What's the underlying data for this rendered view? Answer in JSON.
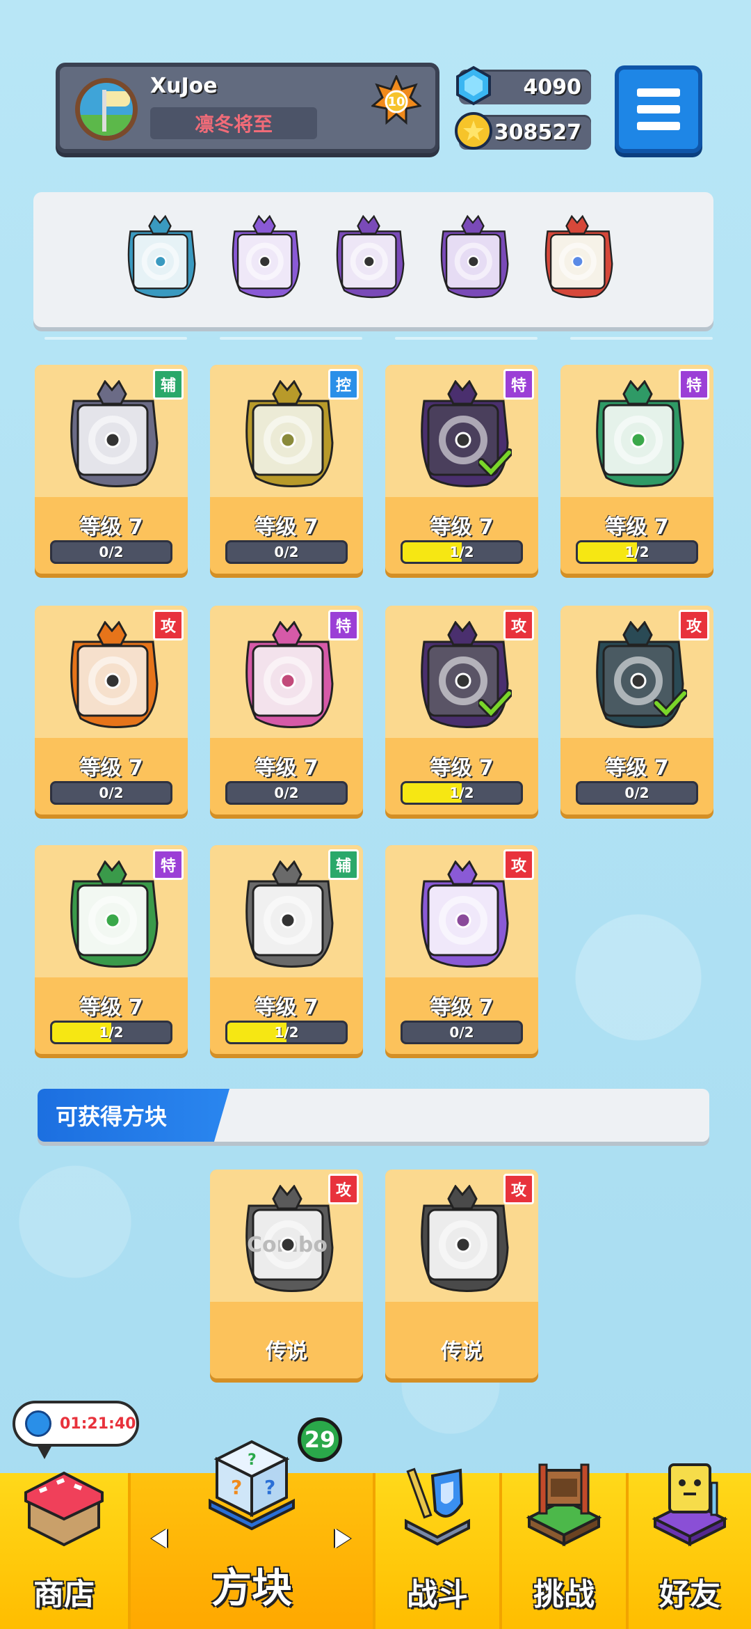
{
  "player": {
    "name": "XuJoe",
    "title": "凛冬将至",
    "rank": "10"
  },
  "currency": {
    "gems": "4090",
    "coins": "308527"
  },
  "colors": {
    "background": "#aee0f3",
    "card": "#fcc25b",
    "progress_fill": "#f6e713",
    "tag_fu": "#2aa86a",
    "tag_kong": "#2a8fe8",
    "tag_te": "#9b3fd6",
    "tag_gong": "#e8323c",
    "nav": "#ffc20e"
  },
  "deck": [
    {
      "icon": "blue-vortex-block-icon"
    },
    {
      "icon": "purple-atom-block-icon"
    },
    {
      "icon": "purple-triangle-block-icon"
    },
    {
      "icon": "purple-shatter-block-icon"
    },
    {
      "icon": "rainbow-infinity-block-icon"
    }
  ],
  "blocks": [
    {
      "icon": "grey-jaw-block-icon",
      "tag": "辅",
      "tag_type": "fu",
      "level": "等级 7",
      "progress": "0/2",
      "fill": 0,
      "equipped": false
    },
    {
      "icon": "gold-shield-block-icon",
      "tag": "控",
      "tag_type": "kong",
      "level": "等级 7",
      "progress": "0/2",
      "fill": 0,
      "equipped": false
    },
    {
      "icon": "dark-purple-triangle-block-icon",
      "tag": "特",
      "tag_type": "te",
      "level": "等级 7",
      "progress": "1/2",
      "fill": 0.5,
      "equipped": true
    },
    {
      "icon": "green-rune-block-icon",
      "tag": "特",
      "tag_type": "te",
      "level": "等级 7",
      "progress": "1/2",
      "fill": 0.5,
      "equipped": false
    },
    {
      "icon": "orange-fire-block-icon",
      "tag": "攻",
      "tag_type": "gong",
      "level": "等级 7",
      "progress": "0/2",
      "fill": 0,
      "equipped": false
    },
    {
      "icon": "pink-cross-block-icon",
      "tag": "特",
      "tag_type": "te",
      "level": "等级 7",
      "progress": "0/2",
      "fill": 0,
      "equipped": false
    },
    {
      "icon": "purple-atom-block-icon",
      "tag": "攻",
      "tag_type": "gong",
      "level": "等级 7",
      "progress": "1/2",
      "fill": 0.5,
      "equipped": true
    },
    {
      "icon": "teal-vortex-block-icon",
      "tag": "攻",
      "tag_type": "gong",
      "level": "等级 7",
      "progress": "0/2",
      "fill": 0,
      "equipped": true
    },
    {
      "icon": "green-wind-block-icon",
      "tag": "特",
      "tag_type": "te",
      "level": "等级 7",
      "progress": "1/2",
      "fill": 0.5,
      "equipped": false
    },
    {
      "icon": "silver-cycle-block-icon",
      "tag": "辅",
      "tag_type": "fu",
      "level": "等级 7",
      "progress": "1/2",
      "fill": 0.5,
      "equipped": false
    },
    {
      "icon": "violet-star-block-icon",
      "tag": "攻",
      "tag_type": "gong",
      "level": "等级 7",
      "progress": "0/2",
      "fill": 0,
      "equipped": false
    }
  ],
  "obtainable": {
    "title": "可获得方块",
    "items": [
      {
        "icon": "combo-block-icon",
        "art_text": "Combo",
        "tag": "攻",
        "tag_type": "gong",
        "rarity": "传说"
      },
      {
        "icon": "black-hole-block-icon",
        "tag": "攻",
        "tag_type": "gong",
        "rarity": "传说"
      }
    ]
  },
  "shop_timer": "01:21:40",
  "nav": {
    "shop": "商店",
    "blocks": "方块",
    "blocks_badge": "29",
    "battle": "战斗",
    "challenge": "挑战",
    "friends": "好友"
  }
}
